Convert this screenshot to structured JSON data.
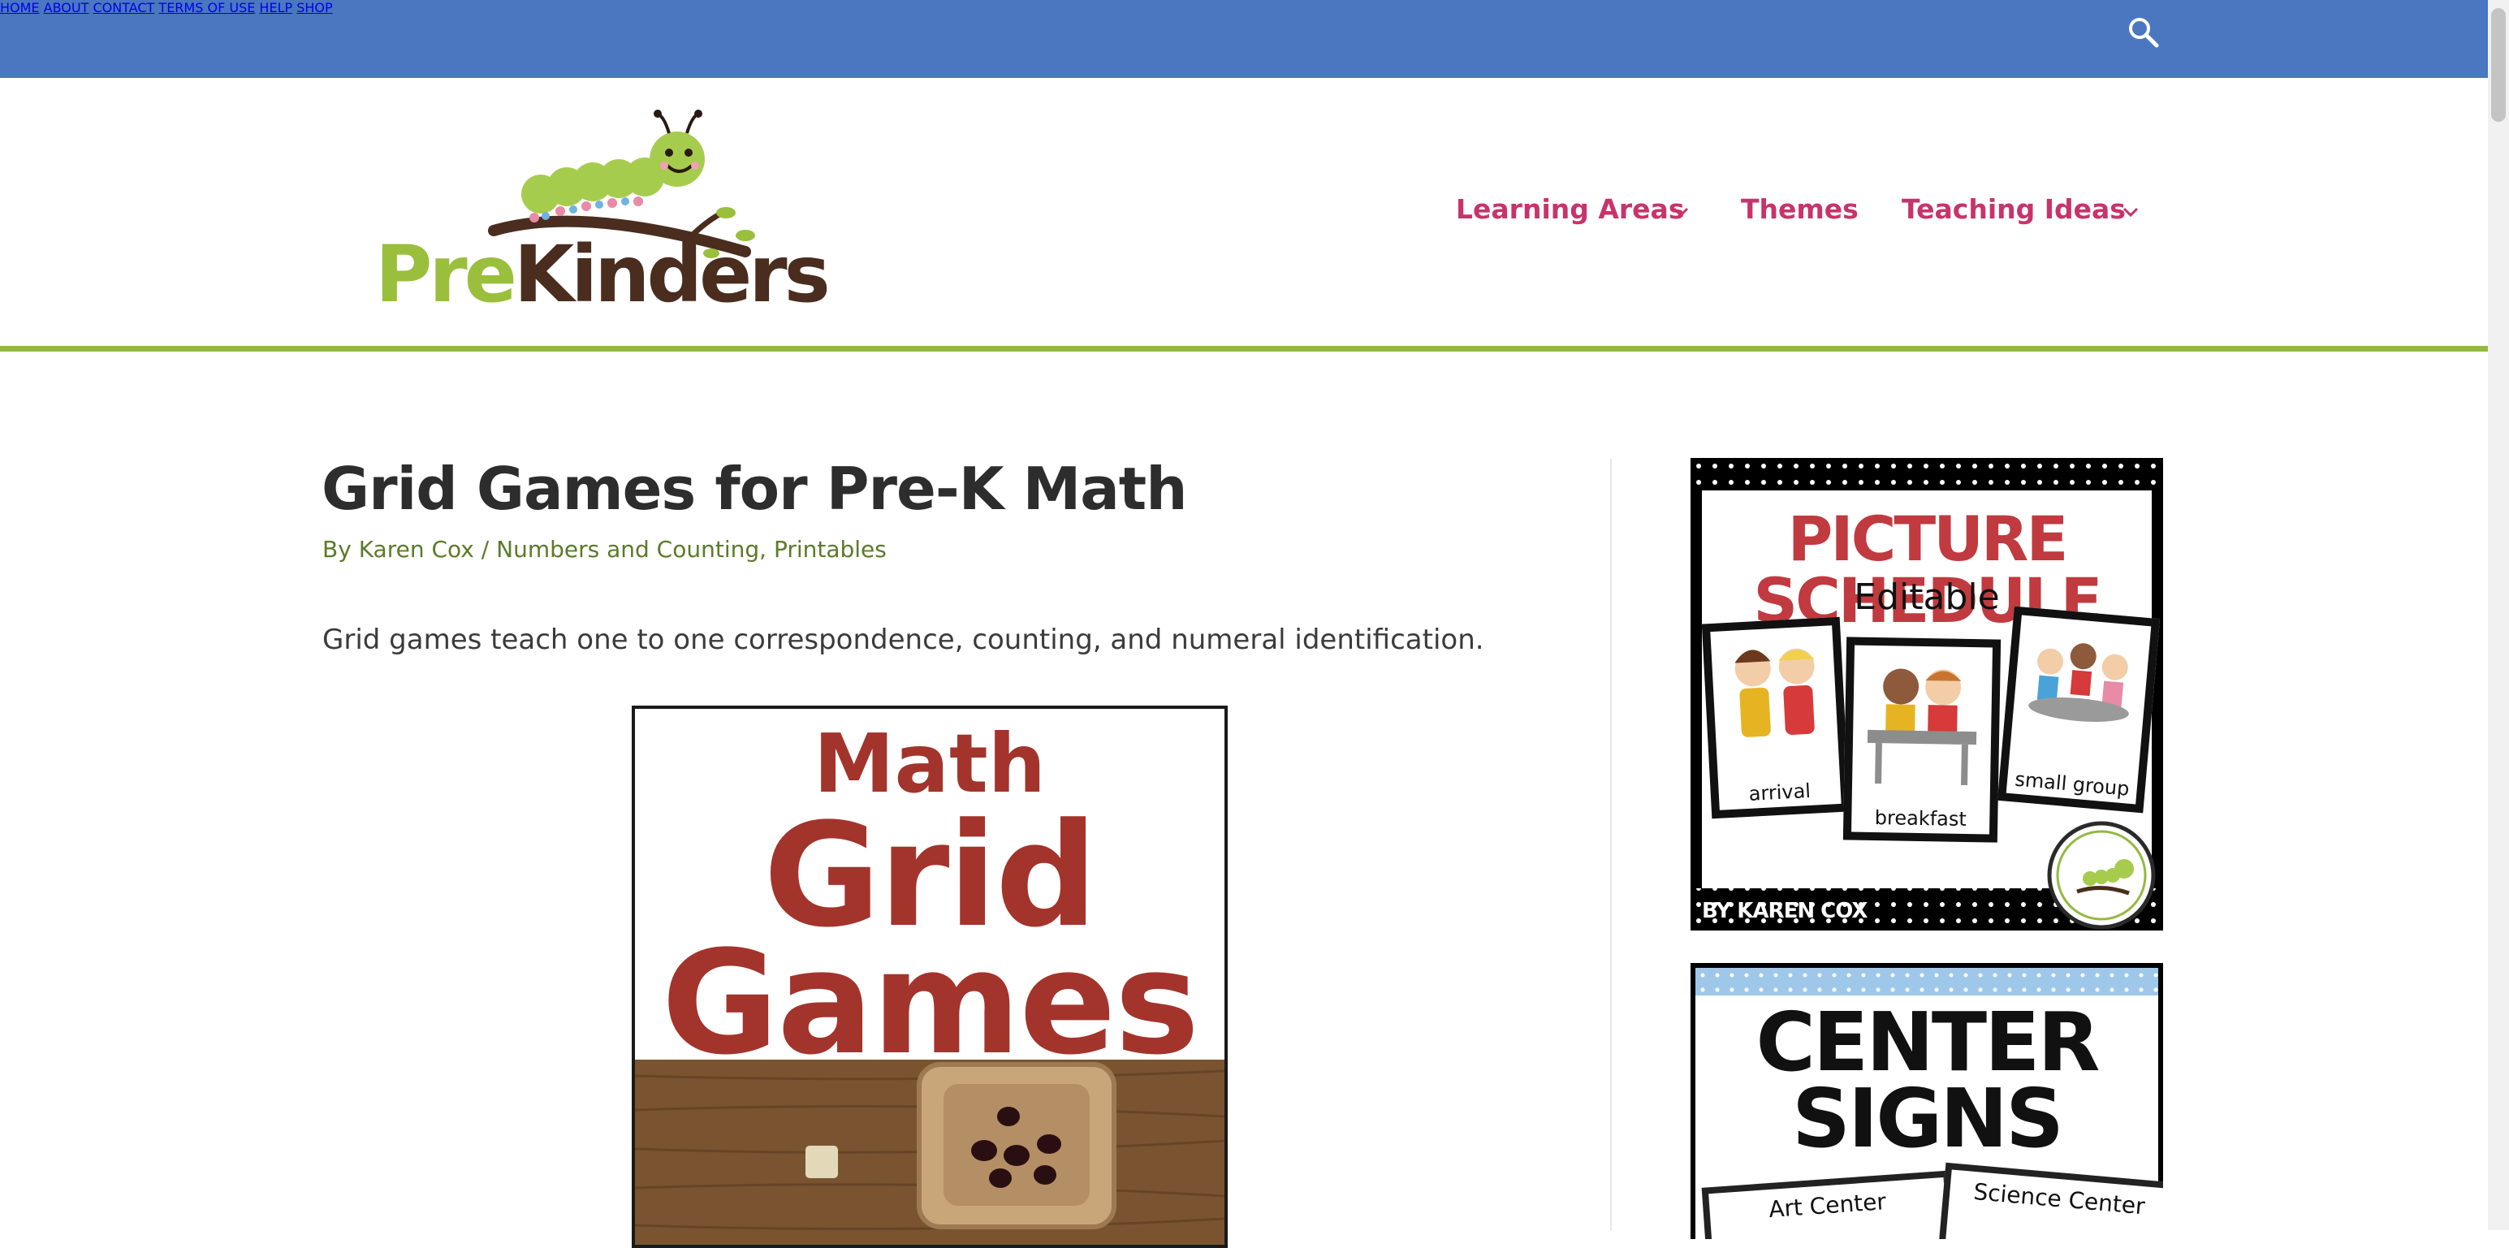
{
  "topbar": {
    "nav": [
      "HOME",
      "ABOUT",
      "CONTACT",
      "TERMS OF USE",
      "HELP",
      "SHOP"
    ]
  },
  "logo": {
    "pre": "Pre",
    "kinders": "Kinders"
  },
  "mainnav": {
    "items": [
      {
        "label": "Learning Areas"
      },
      {
        "label": "Themes"
      },
      {
        "label": "Teaching Ideas"
      }
    ]
  },
  "article": {
    "title": "Grid Games for Pre-K Math",
    "meta_by": "By",
    "author": "Karen Cox",
    "sep": "/",
    "categories": [
      "Numbers and Counting",
      "Printables"
    ],
    "comma": ",",
    "intro": "Grid games teach one to one correspondence, counting, and numeral identification.",
    "feature_image": {
      "line1": "Math",
      "line2": "Grid",
      "line3": "Games"
    }
  },
  "sidebar": {
    "ad1": {
      "title": "PICTURE SCHEDULE",
      "subtitle": "Editable",
      "cards": [
        "arrival",
        "breakfast",
        "small group"
      ],
      "byline": "BY KAREN COX"
    },
    "ad2": {
      "title_line1": "CENTER",
      "title_line2": "SIGNS",
      "cards": [
        "Art Center",
        "Science Center"
      ]
    }
  },
  "colors": {
    "topbar": "#4a77bf",
    "nav_pink": "#c8336b",
    "rule_green": "#93b941",
    "meta_green": "#5c7a29",
    "heading": "#2d2d2d",
    "feature_red": "#a3342c"
  }
}
